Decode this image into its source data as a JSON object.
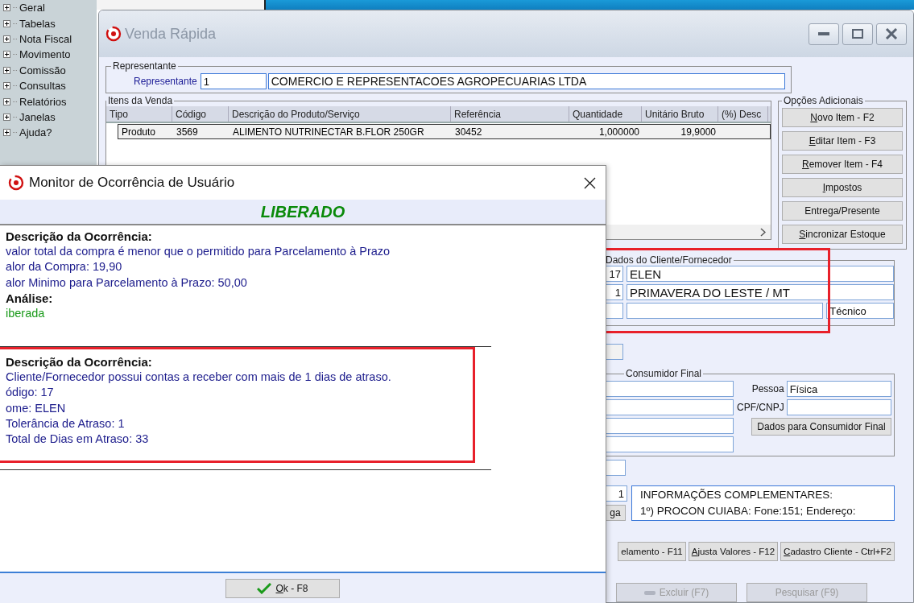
{
  "sidebar": {
    "items": [
      {
        "label": "Geral",
        "expanded": false
      },
      {
        "label": "Tabelas",
        "expanded": false
      },
      {
        "label": "Nota Fiscal",
        "expanded": false
      },
      {
        "label": "Movimento",
        "expanded": false
      },
      {
        "label": "Comissão",
        "expanded": false
      },
      {
        "label": "Consultas",
        "expanded": false
      },
      {
        "label": "Relatórios",
        "expanded": false
      },
      {
        "label": "Janelas",
        "expanded": false
      },
      {
        "label": "Ajuda?",
        "expanded": false
      }
    ]
  },
  "window": {
    "title": "Venda Rápida"
  },
  "representante": {
    "legend": "Representante",
    "label": "Representante",
    "code": "1",
    "name": "COMERCIO E REPRESENTACOES AGROPECUARIAS LTDA"
  },
  "items": {
    "legend": "Itens da Venda",
    "columns": [
      "Tipo",
      "Código",
      "Descrição do Produto/Serviço",
      "Referência",
      "Quantidade",
      "Unitário Bruto",
      "(%) Desc"
    ],
    "rows": [
      {
        "cells": [
          "Produto",
          "3569",
          "ALIMENTO NUTRINECTAR B.FLOR 250GR",
          "30452",
          "1,000000",
          "19,9000",
          null
        ],
        "selected": true
      }
    ]
  },
  "options": {
    "legend": "Opções Adicionais",
    "buttons": [
      {
        "key": "N",
        "text": "ovo Item - F2"
      },
      {
        "key": "E",
        "text": "ditar Item - F3"
      },
      {
        "key": "R",
        "text": "emover Item - F4"
      },
      {
        "key": "I",
        "text": "mpostos"
      },
      {
        "text": "Entrega/Presente"
      },
      {
        "key": "S",
        "text": "incronizar Estoque"
      }
    ]
  },
  "client": {
    "legend": "Dados do Cliente/Fornecedor",
    "rows": [
      {
        "code": "17",
        "name": "ELEN"
      },
      {
        "code": "1",
        "name": "PRIMAVERA DO LESTE / MT"
      },
      {
        "extra": "Técnico"
      }
    ]
  },
  "consumer": {
    "legend": "Consumidor Final",
    "pessoa_label": "Pessoa",
    "pessoa": "Física",
    "cpf_label": "CPF/CNPJ",
    "button": "Dados para Consumidor Final"
  },
  "info": {
    "quantity": "1",
    "button": "ga",
    "lines": [
      "INFORMAÇÕES COMPLEMENTARES:",
      "1º) PROCON CUIABA: Fone:151; Endereço:"
    ]
  },
  "actions": [
    {
      "text": "elamento - F11"
    },
    {
      "key": "A",
      "text": "justa Valores - F12"
    },
    {
      "key": "C",
      "text": "adastro Cliente - Ctrl+F2"
    }
  ],
  "bottom_actions": [
    {
      "text": "Excluir (F7)",
      "disabled": true
    },
    {
      "text": "Pesquisar (F9)",
      "disabled": true
    }
  ],
  "dialog": {
    "title": "Monitor de Ocorrência de Usuário",
    "status": "LIBERADO",
    "sections": [
      {
        "heading": "Descrição da Ocorrência:",
        "lines": [
          "valor total da compra é menor que o permitido para Parcelamento à Prazo",
          "alor da Compra: 19,90",
          "alor Minimo para Parcelamento à Prazo: 50,00"
        ],
        "analysis_heading": "Análise:",
        "analysis": "iberada",
        "highlighted": false
      },
      {
        "heading": "Descrição da Ocorrência:",
        "lines": [
          "Cliente/Fornecedor possui contas a receber com mais de 1 dias de atraso.",
          "ódigo: 17",
          "ome: ELEN",
          "Tolerância de Atraso: 1",
          "Total de Dias em Atraso: 33"
        ],
        "highlighted": true
      }
    ],
    "ok": {
      "key": "O",
      "text": "k - F8"
    }
  }
}
